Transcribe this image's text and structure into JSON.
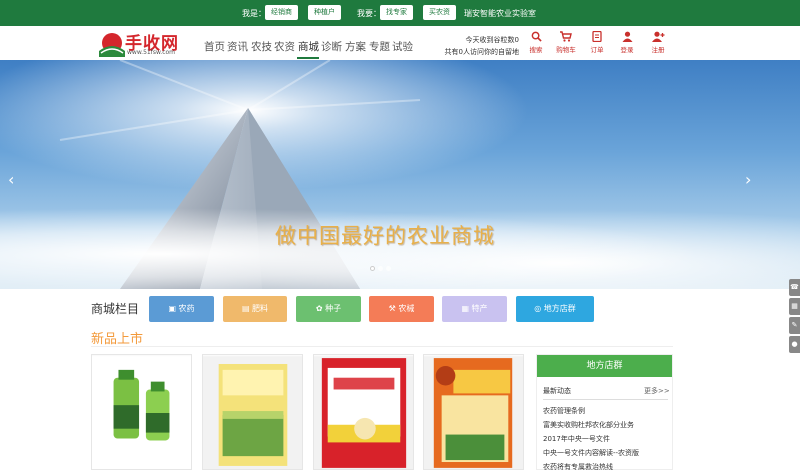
{
  "topbar": {
    "iam_label": "我是：",
    "role1": "经销商",
    "role2": "种植户",
    "want_label": "我要：",
    "action1": "找专家",
    "action2": "买农资",
    "lab_text": "瑞安智能农业实验室"
  },
  "logo": {
    "word": "手收网",
    "url": "www.51fsw.com"
  },
  "nav": [
    "首页",
    "资讯",
    "农技",
    "农资",
    "商城",
    "诊断",
    "方案",
    "专题",
    "试验"
  ],
  "stats": {
    "line1": "今天收到谷粒数0",
    "line2": "共有0人访问你的自留地"
  },
  "tools": [
    {
      "icon": "search-icon",
      "label": "搜索"
    },
    {
      "icon": "cart-icon",
      "label": "购物车"
    },
    {
      "icon": "order-icon",
      "label": "订单"
    },
    {
      "icon": "user-icon",
      "label": "登录"
    },
    {
      "icon": "user-plus-icon",
      "label": "注册"
    }
  ],
  "banner": {
    "slogan": "做中国最好的农业商城",
    "prev": "‹",
    "next": "›"
  },
  "categories": {
    "title": "商城栏目",
    "items": [
      {
        "label": "农药",
        "color": "#5b9bd5"
      },
      {
        "label": "肥料",
        "color": "#f0b96b"
      },
      {
        "label": "种子",
        "color": "#6cc070"
      },
      {
        "label": "农械",
        "color": "#f47c57"
      },
      {
        "label": "特产",
        "color": "#c9c2f0"
      },
      {
        "label": "地方店群",
        "color": "#2ea7e0"
      }
    ]
  },
  "new_products": {
    "title": "新品上市"
  },
  "side": {
    "title": "地方店群",
    "sub": "最新动态",
    "more": "更多>>",
    "items": [
      "农药管理条例",
      "富美实收购杜邦农化部分业务",
      "2017年中央一号文件",
      "中央一号文件内容解读--农资版",
      "农药将有专属救治热线"
    ]
  }
}
